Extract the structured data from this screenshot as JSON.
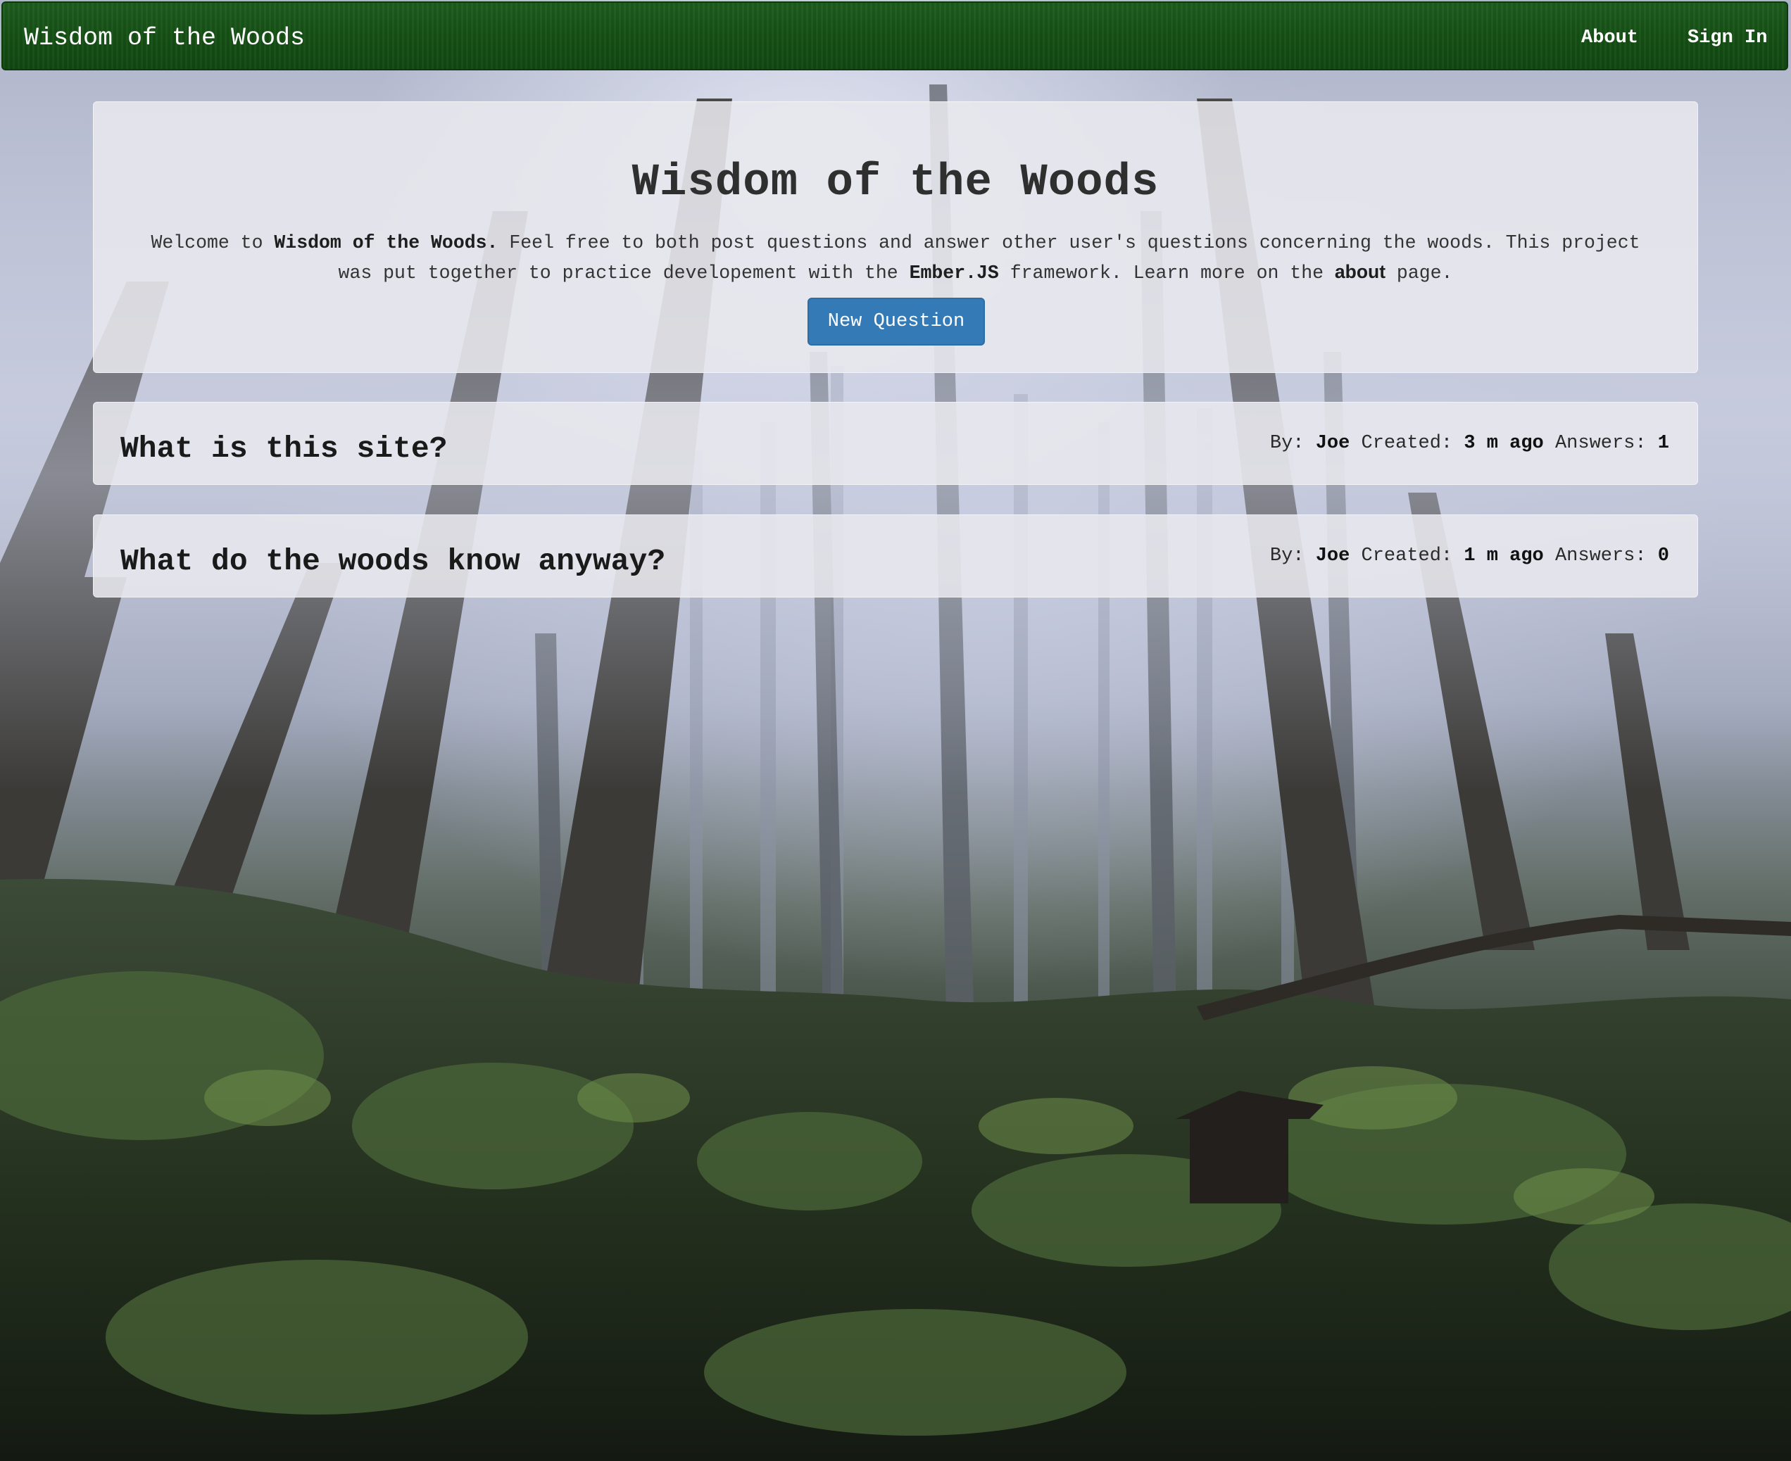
{
  "navbar": {
    "brand": "Wisdom of the Woods",
    "links": [
      {
        "label": "About"
      },
      {
        "label": "Sign In"
      }
    ]
  },
  "hero": {
    "title": "Wisdom of the Woods",
    "intro": {
      "t1": "Welcome to ",
      "site_name": "Wisdom of the Woods.",
      "t2": " Feel free to both post questions and answer other user's questions concerning the woods. This project was put together to practice developement with the ",
      "framework": "Ember.JS",
      "t3": " framework. Learn more on the ",
      "about_link": "about",
      "t4": " page."
    },
    "new_question_label": "New Question"
  },
  "questions": [
    {
      "title": "What is this site?",
      "by_label": "By:",
      "author": "Joe",
      "created_label": "Created:",
      "created": "3 m ago",
      "answers_label": "Answers:",
      "answers": "1"
    },
    {
      "title": "What do the woods know anyway?",
      "by_label": "By:",
      "author": "Joe",
      "created_label": "Created:",
      "created": "1 m ago",
      "answers_label": "Answers:",
      "answers": "0"
    }
  ],
  "colors": {
    "navbar": "#155015",
    "primary_button": "#337ab7",
    "panel": "#e8e8ee"
  }
}
